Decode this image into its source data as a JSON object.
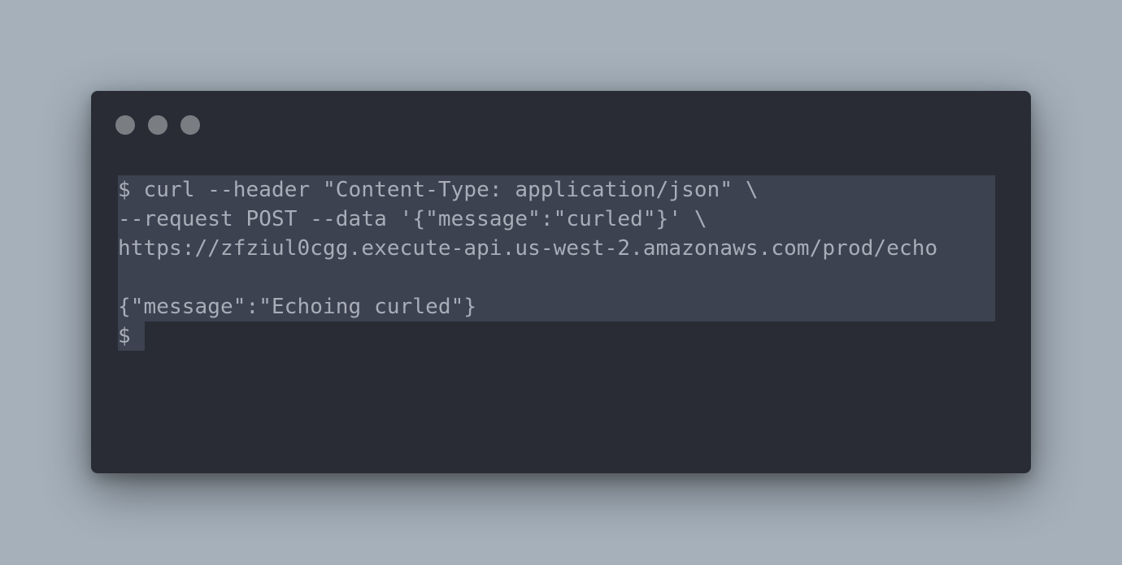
{
  "window": {
    "controls": [
      "close-dot",
      "minimize-dot",
      "maximize-dot"
    ]
  },
  "terminal": {
    "lines": [
      "$ curl --header \"Content-Type: application/json\" \\",
      "--request POST --data '{\"message\":\"curled\"}' \\",
      "https://zfziul0cgg.execute-api.us-west-2.amazonaws.com/prod/echo",
      "",
      "{\"message\":\"Echoing curled\"}",
      "$"
    ]
  },
  "colors": {
    "background": "#a5b0bb",
    "window": "#292c35",
    "selection": "#3c4250",
    "text": "#a8aeb8",
    "window_dots": "#7a7d82"
  }
}
